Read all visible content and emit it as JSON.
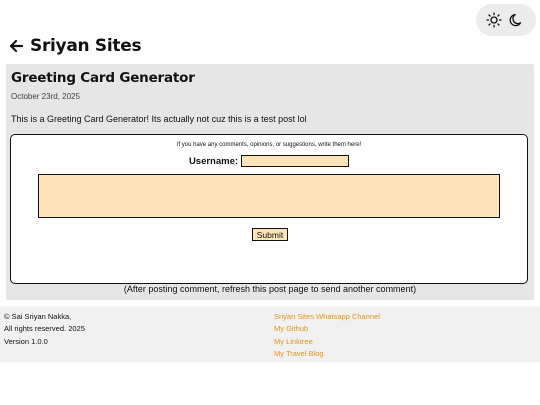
{
  "header": {
    "site_title": "Sriyan Sites"
  },
  "theme_toggle": {
    "light_icon": "sun-icon",
    "dark_icon": "moon-icon"
  },
  "post": {
    "title": "Greeting Card Generator",
    "date": "October 23rd, 2025",
    "body": "This is a Greeting Card Generator! Its actually not cuz this is a test post lol"
  },
  "comment_form": {
    "prompt": "If you have any comments, opinions, or suggestions, write them here!",
    "username_label": "Username:",
    "username_value": "",
    "comment_value": "",
    "submit_label": "Submit",
    "after_note": "(After posting comment, refresh this post page to send another comment)"
  },
  "footer": {
    "copyright_line1": "© Sai Sriyan Nakka,",
    "copyright_line2": "All rights reserved. 2025",
    "version": "Version 1.0.0",
    "links": [
      "Sriyan Sites Whatsapp Channel",
      "My Github",
      "My Linktree",
      "My Travel Blog"
    ]
  },
  "colors": {
    "accent_link": "#e29418",
    "input_fill": "#fde3b8",
    "card_bg": "#e6e6e6"
  }
}
